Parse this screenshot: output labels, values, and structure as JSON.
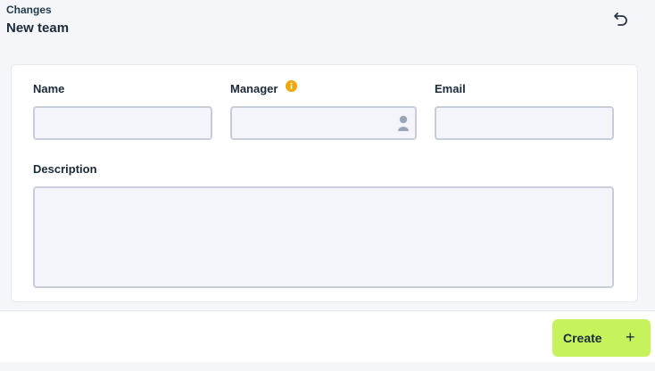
{
  "header": {
    "breadcrumb": "Changes",
    "title": "New team",
    "undo_icon": "undo-icon"
  },
  "form": {
    "name_label": "Name",
    "name_value": "",
    "manager_label": "Manager",
    "manager_value": "",
    "manager_info_icon": "info-icon",
    "manager_person_icon": "person-icon",
    "email_label": "Email",
    "email_value": "",
    "description_label": "Description",
    "description_value": ""
  },
  "footer": {
    "create_label": "Create",
    "create_icon": "plus-icon"
  },
  "colors": {
    "accent": "#c6f35c",
    "info": "#f0a808",
    "input_border": "#c6cedb"
  }
}
